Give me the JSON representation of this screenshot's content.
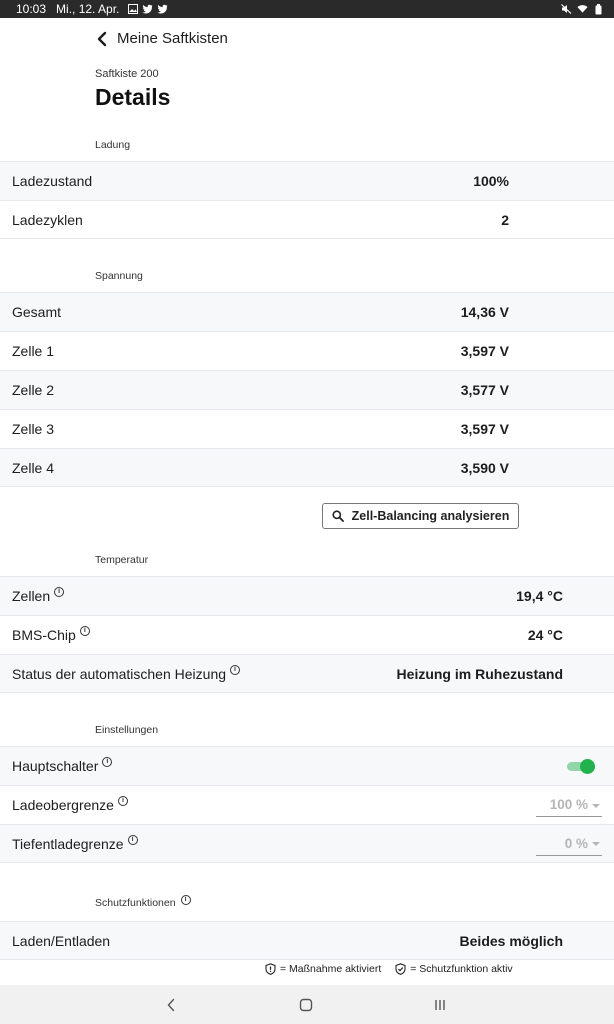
{
  "status_bar": {
    "time": "10:03",
    "date": "Mi., 12. Apr.",
    "icons_left": [
      "gallery-icon",
      "twitter-icon",
      "twitter-icon"
    ],
    "icons_right": [
      "mute-icon",
      "wifi-icon",
      "battery-icon"
    ]
  },
  "header": {
    "back_label": "Meine Saftkisten",
    "subtitle": "Saftkiste 200",
    "title": "Details"
  },
  "sections": {
    "ladung": "Ladung",
    "spannung": "Spannung",
    "temperatur": "Temperatur",
    "einstellungen": "Einstellungen",
    "schutzfunktionen": "Schutzfunktionen"
  },
  "ladung": {
    "ladezustand_label": "Ladezustand",
    "ladezustand_value": "100%",
    "ladezyklen_label": "Ladezyklen",
    "ladezyklen_value": "2"
  },
  "spannung": {
    "gesamt_label": "Gesamt",
    "gesamt_value": "14,36 V",
    "zelle1_label": "Zelle 1",
    "zelle1_value": "3,597 V",
    "zelle2_label": "Zelle 2",
    "zelle2_value": "3,577 V",
    "zelle3_label": "Zelle 3",
    "zelle3_value": "3,597 V",
    "zelle4_label": "Zelle 4",
    "zelle4_value": "3,590 V",
    "analyze_button": "Zell-Balancing analysieren"
  },
  "temperatur": {
    "zellen_label": "Zellen",
    "zellen_value": "19,4 °C",
    "bms_label": "BMS-Chip",
    "bms_value": "24 °C",
    "heizung_label": "Status der automatischen Heizung",
    "heizung_value": "Heizung im Ruhezustand"
  },
  "einstellungen": {
    "hauptschalter_label": "Hauptschalter",
    "hauptschalter_on": true,
    "ladeobergrenze_label": "Ladeobergrenze",
    "ladeobergrenze_value": "100 %",
    "tiefentladegrenze_label": "Tiefentladegrenze",
    "tiefentladegrenze_value": "0 %"
  },
  "schutz": {
    "laden_label": "Laden/Entladen",
    "laden_value": "Beides möglich"
  },
  "legend": {
    "massnahme": "= Maßnahme aktiviert",
    "schutzfunktion": "= Schutzfunktion aktiv"
  },
  "colors": {
    "accent_green": "#22b14c",
    "row_shade": "#f7f8fa",
    "status_bar": "#2a2a2a"
  }
}
